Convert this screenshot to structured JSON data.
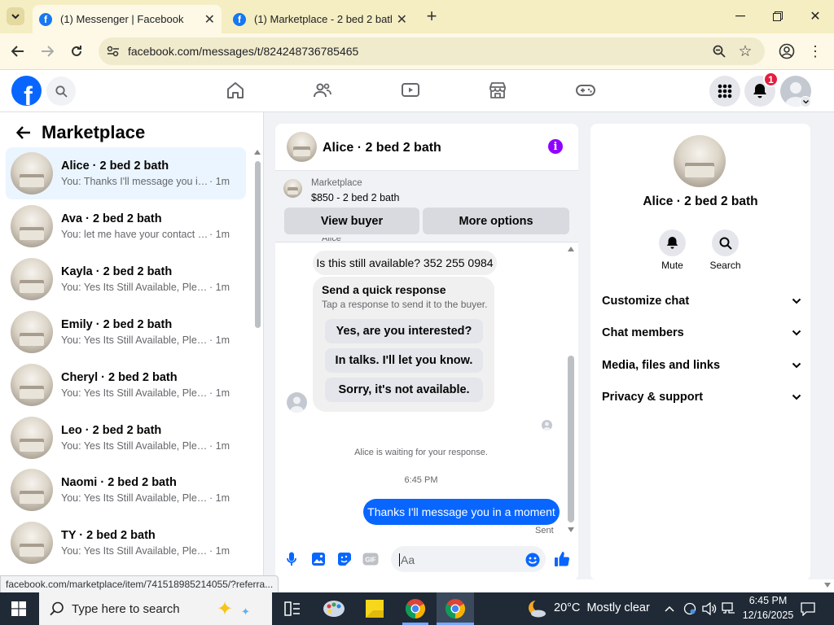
{
  "browser": {
    "tabs": [
      {
        "title": "(1) Messenger | Facebook",
        "active": true
      },
      {
        "title": "(1) Marketplace - 2 bed 2 bath",
        "active": false
      }
    ],
    "url": "facebook.com/messages/t/824248736785465",
    "status_url": "facebook.com/marketplace/item/741518985214055/?referra..."
  },
  "fb": {
    "notification_count": "1"
  },
  "sidebar": {
    "title": "Marketplace",
    "conversations": [
      {
        "name": "Alice · 2 bed 2 bath",
        "preview": "You: Thanks I'll message you in a ...",
        "time": "· 1m",
        "active": true
      },
      {
        "name": "Ava · 2 bed 2 bath",
        "preview": "You: let me have your contact nu...",
        "time": "· 1m"
      },
      {
        "name": "Kayla · 2 bed 2 bath",
        "preview": "You: Yes Its Still Available, Please S...",
        "time": "· 1m"
      },
      {
        "name": "Emily · 2 bed 2 bath",
        "preview": "You: Yes Its Still Available, Please S...",
        "time": "· 1m"
      },
      {
        "name": "Cheryl · 2 bed 2 bath",
        "preview": "You: Yes Its Still Available, Please S...",
        "time": "· 1m"
      },
      {
        "name": "Leo · 2 bed 2 bath",
        "preview": "You: Yes Its Still Available, Please S...",
        "time": "· 1m"
      },
      {
        "name": "Naomi · 2 bed 2 bath",
        "preview": "You: Yes Its Still Available, Please S...",
        "time": "· 1m"
      },
      {
        "name": "TY · 2 bed 2 bath",
        "preview": "You: Yes Its Still Available, Please S...",
        "time": "· 1m"
      }
    ]
  },
  "chat": {
    "header_name": "Alice · 2 bed 2 bath",
    "listing_label": "Marketplace",
    "listing_price": "$850 - 2 bed 2 bath",
    "view_buyer": "View buyer",
    "more_options": "More options",
    "sender_label": "Alice",
    "incoming_message": "Is this still available? 352 255 0984",
    "quick_title": "Send a quick response",
    "quick_subtitle": "Tap a response to send it to the buyer.",
    "quick_responses": [
      "Yes, are you interested?",
      "In talks. I'll let you know.",
      "Sorry, it's not available."
    ],
    "waiting_text": "Alice is waiting for your response.",
    "timestamp": "6:45 PM",
    "outgoing_message": "Thanks I'll message you in a moment",
    "sent_label": "Sent",
    "composer_placeholder": "Aa"
  },
  "info": {
    "name": "Alice · 2 bed 2 bath",
    "mute": "Mute",
    "search": "Search",
    "sections": [
      "Customize chat",
      "Chat members",
      "Media, files and links",
      "Privacy & support"
    ]
  },
  "taskbar": {
    "search_placeholder": "Type here to search",
    "weather": "20°C  Mostly clear",
    "time": "6:45 PM",
    "date": "12/16/2025"
  },
  "colors": {
    "accent": "#0866ff",
    "fb_blue": "#1877f2",
    "notif_red": "#e41e3f",
    "info_purple": "#9000ff"
  }
}
